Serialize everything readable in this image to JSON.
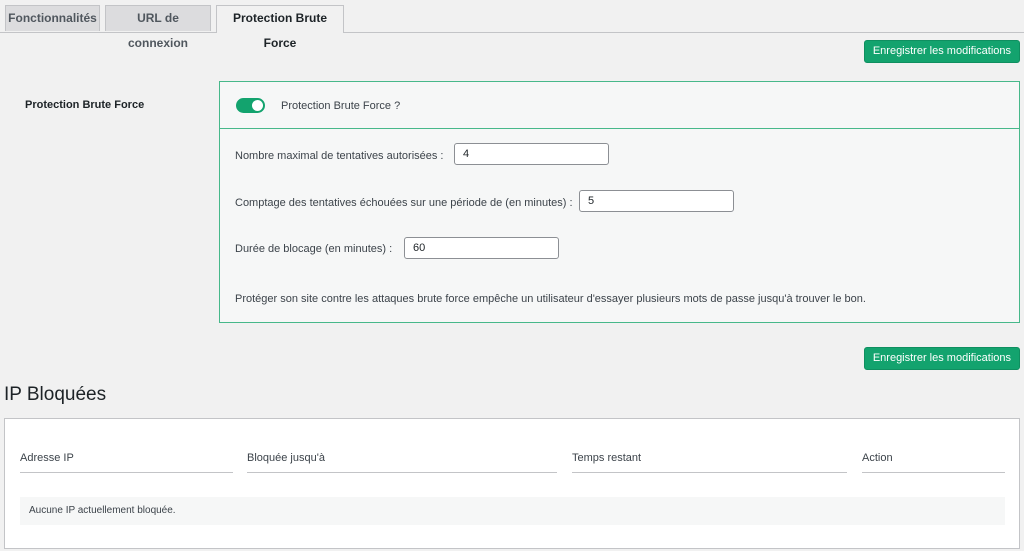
{
  "tabs": [
    {
      "label": "Fonctionnalités",
      "active": false
    },
    {
      "label": "URL de connexion",
      "active": false
    },
    {
      "label": "Protection Brute Force",
      "active": true
    }
  ],
  "save_button_label": "Enregistrer les modifications",
  "section": {
    "label": "Protection Brute Force",
    "toggle_label": "Protection Brute Force ?",
    "toggle_on": true,
    "fields": [
      {
        "label": "Nombre maximal de tentatives autorisées :",
        "value": "4"
      },
      {
        "label": "Comptage des tentatives échouées sur une période de (en minutes) :",
        "value": "5"
      },
      {
        "label": "Durée de blocage (en minutes) :",
        "value": "60"
      }
    ],
    "help_text": "Protéger son site contre les attaques brute force empêche un utilisateur d'essayer plusieurs mots de passe jusqu'à trouver le bon."
  },
  "blocked": {
    "title": "IP Bloquées",
    "columns": [
      "Adresse IP",
      "Bloquée jusqu'à",
      "Temps restant",
      "Action"
    ],
    "empty_message": "Aucune IP actuellement bloquée."
  },
  "colors": {
    "accent": "#13a36e",
    "panel_border": "#47b88a"
  }
}
